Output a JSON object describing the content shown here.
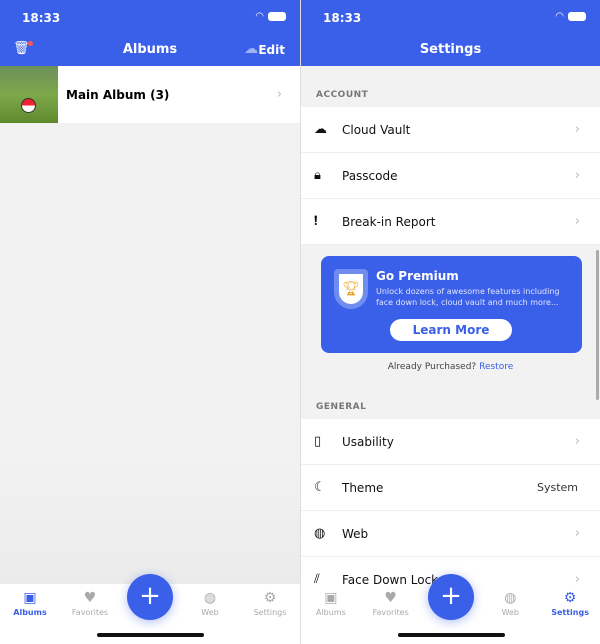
{
  "status": {
    "time": "18:33"
  },
  "albums_screen": {
    "title": "Albums",
    "edit": "Edit",
    "albums": [
      {
        "name": "Main Album (3)"
      }
    ]
  },
  "settings_screen": {
    "title": "Settings",
    "account_header": "ACCOUNT",
    "account": [
      {
        "label": "Cloud Vault",
        "icon": "cloud-icon"
      },
      {
        "label": "Passcode",
        "icon": "lock-icon"
      },
      {
        "label": "Break-in Report",
        "icon": "alert-icon"
      }
    ],
    "premium": {
      "title": "Go Premium",
      "description": "Unlock dozens of awesome features including face down lock, cloud vault and much more...",
      "button": "Learn More",
      "already": "Already Purchased?",
      "restore": "Restore"
    },
    "general_header": "GENERAL",
    "general": [
      {
        "label": "Usability",
        "icon": "phone-icon"
      },
      {
        "label": "Theme",
        "icon": "moon-icon",
        "value": "System"
      },
      {
        "label": "Web",
        "icon": "globe-icon"
      },
      {
        "label": "Face Down Lock",
        "icon": "face-down-icon"
      }
    ]
  },
  "tabs": [
    {
      "label": "Albums"
    },
    {
      "label": "Favorites"
    },
    {
      "label": "Web"
    },
    {
      "label": "Settings"
    }
  ],
  "accent": "#3a5fe8"
}
